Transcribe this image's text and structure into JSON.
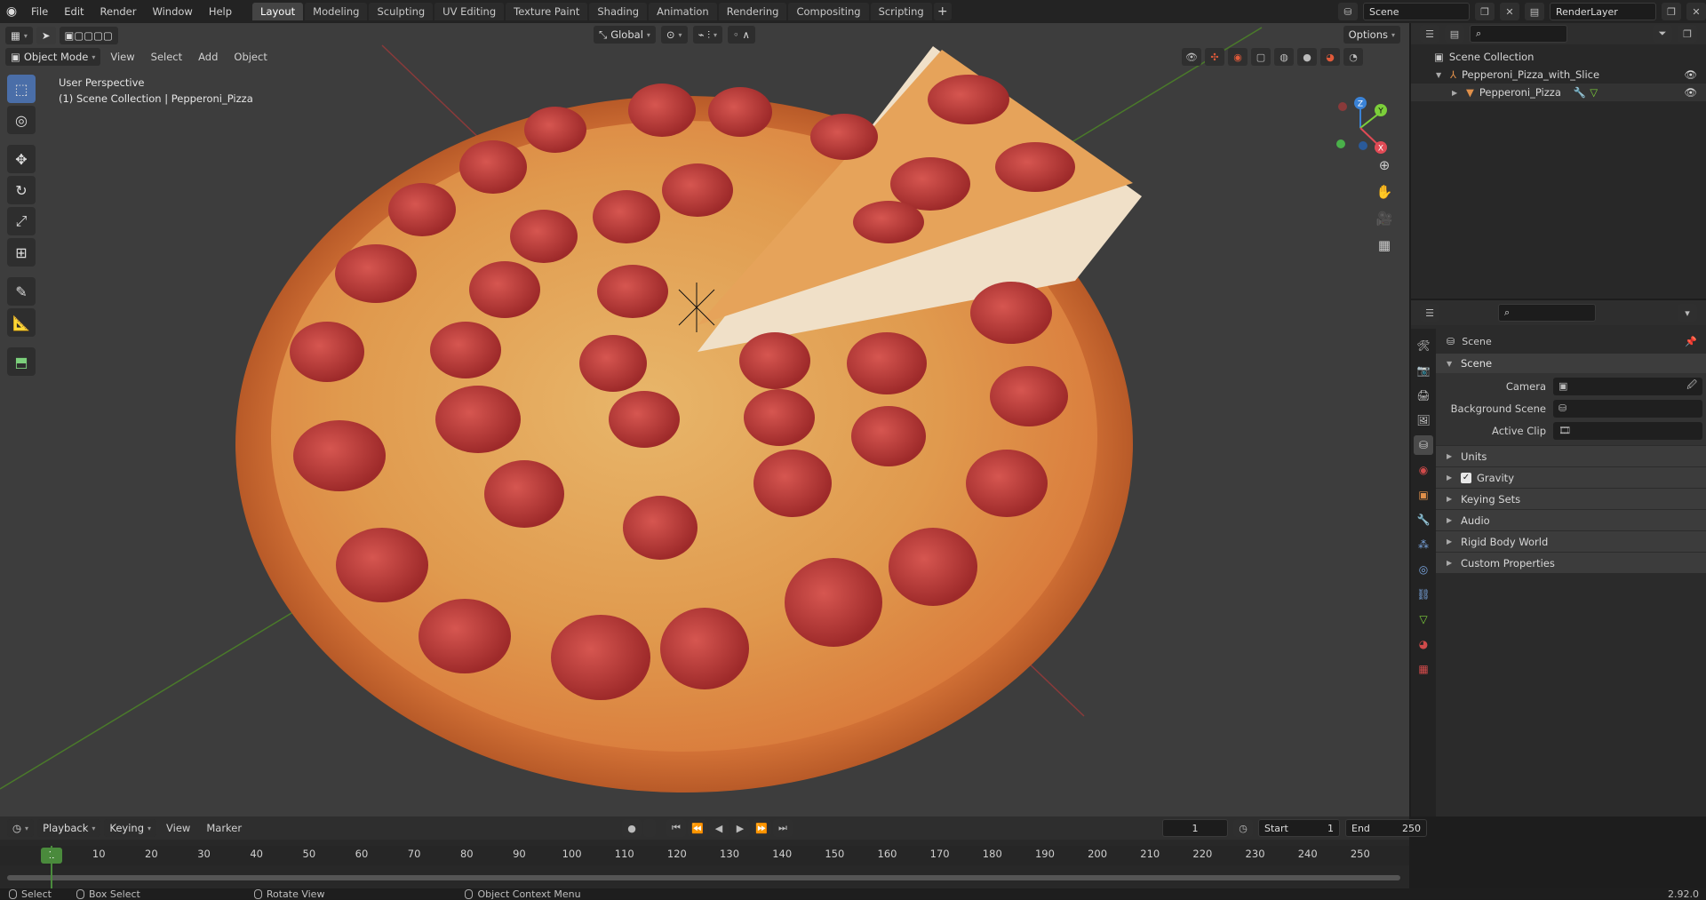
{
  "topbar": {
    "menus": [
      "File",
      "Edit",
      "Render",
      "Window",
      "Help"
    ],
    "workspace_tabs": [
      "Layout",
      "Modeling",
      "Sculpting",
      "UV Editing",
      "Texture Paint",
      "Shading",
      "Animation",
      "Rendering",
      "Compositing",
      "Scripting"
    ],
    "active_tab": "Layout",
    "scene_name": "Scene",
    "view_layer": "RenderLayer"
  },
  "viewport": {
    "mode": "Object Mode",
    "menus": [
      "View",
      "Select",
      "Add",
      "Object"
    ],
    "transform_orientation": "Global",
    "options_label": "Options",
    "perspective_text": "User Perspective",
    "collection_text": "(1) Scene Collection | Pepperoni_Pizza",
    "gizmo_axes": {
      "x": "X",
      "y": "Y",
      "z": "Z"
    },
    "colors": {
      "x_axis": "#e04a55",
      "y_axis": "#7ccf3a",
      "z_axis": "#3a82d6",
      "grid_x": "#8a3a3a",
      "grid_y": "#4a7a2a"
    }
  },
  "outliner": {
    "root": "Scene Collection",
    "items": [
      {
        "label": "Pepperoni_Pizza_with_Slice",
        "icon": "empty-icon"
      },
      {
        "label": "Pepperoni_Pizza",
        "icon": "mesh-icon"
      }
    ]
  },
  "properties": {
    "context": "Scene",
    "section": "Scene",
    "fields": [
      {
        "label": "Camera",
        "value": ""
      },
      {
        "label": "Background Scene",
        "value": ""
      },
      {
        "label": "Active Clip",
        "value": ""
      }
    ],
    "subsections": [
      "Units",
      "Gravity",
      "Keying Sets",
      "Audio",
      "Rigid Body World",
      "Custom Properties"
    ],
    "gravity_checked": true
  },
  "timeline": {
    "menus": [
      "Playback",
      "Keying",
      "View",
      "Marker"
    ],
    "current_frame": "1",
    "start_label": "Start",
    "start": "1",
    "end_label": "End",
    "end": "250",
    "ticks": [
      "10",
      "20",
      "30",
      "40",
      "50",
      "60",
      "70",
      "80",
      "90",
      "100",
      "110",
      "120",
      "130",
      "140",
      "150",
      "160",
      "170",
      "180",
      "190",
      "200",
      "210",
      "220",
      "230",
      "240",
      "250"
    ],
    "cursor_frame": "1"
  },
  "statusbar": {
    "items": [
      "Select",
      "Box Select",
      "Rotate View",
      "Object Context Menu"
    ],
    "version": "2.92.0"
  }
}
